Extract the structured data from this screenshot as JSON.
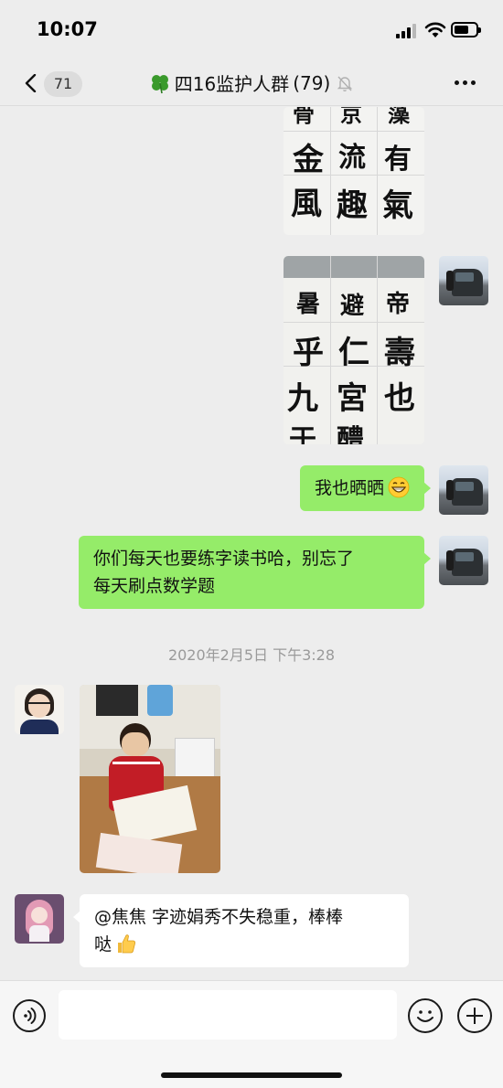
{
  "status_bar": {
    "time": "10:07",
    "battery_level": 0.7,
    "signal_bars": 3
  },
  "nav": {
    "unread_count": "71",
    "chat_title": "四16监护人群",
    "member_count": "(79)",
    "muted": true
  },
  "messages": [
    {
      "type": "image",
      "sender": "me",
      "content": "calligraphy-practice-1",
      "chars": [
        "金",
        "流",
        "有",
        "風",
        "趣",
        "氣"
      ],
      "top_chars": [
        "骨",
        "京",
        "藻"
      ]
    },
    {
      "type": "image",
      "sender": "me",
      "content": "calligraphy-practice-2",
      "chars": [
        "暑",
        "避",
        "帝",
        "乎",
        "仁",
        "壽",
        "九",
        "宮",
        "也"
      ],
      "bottom_chars": [
        "于",
        "醴"
      ]
    },
    {
      "type": "text",
      "sender": "me",
      "text": "我也晒晒",
      "emoji": "grinning-face"
    },
    {
      "type": "text",
      "sender": "me",
      "lines": [
        "你们每天也要练字读书哈，别忘了",
        "每天刷点数学题"
      ]
    },
    {
      "type": "timestamp",
      "text": "2020年2月5日 下午3:28"
    },
    {
      "type": "image",
      "sender": "teacher",
      "content": "child-writing-photo"
    },
    {
      "type": "text",
      "sender": "member",
      "lines": [
        "@焦焦 字迹娟秀不失稳重，棒棒",
        "哒"
      ],
      "emoji": "thumbs-up"
    }
  ],
  "input": {
    "placeholder": "",
    "value": ""
  },
  "colors": {
    "background": "#ededed",
    "bubble_me": "#95ec69",
    "bubble_other": "#ffffff",
    "timestamp": "#9a9a9a"
  }
}
